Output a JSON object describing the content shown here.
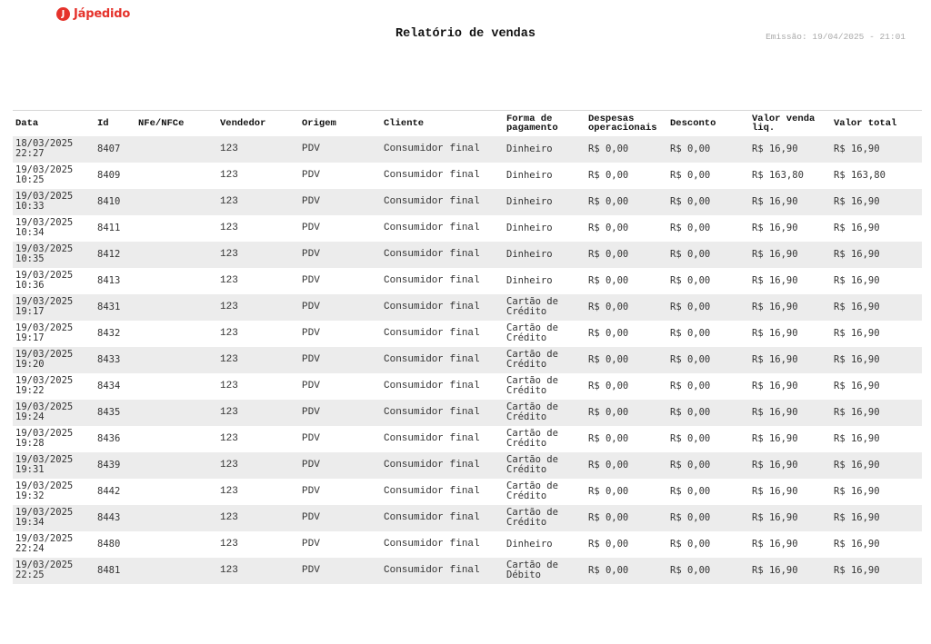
{
  "header": {
    "logo_text": "Jápedido",
    "title": "Relatório de vendas",
    "emission": "Emissão: 19/04/2025 - 21:01"
  },
  "table": {
    "columns": {
      "data": "Data",
      "id": "Id",
      "nfe": "NFe/NFCe",
      "vendedor": "Vendedor",
      "origem": "Origem",
      "cliente": "Cliente",
      "forma_1": "Forma de",
      "forma_2": "pagamento",
      "despesas_1": "Despesas",
      "despesas_2": "operacionais",
      "desconto": "Desconto",
      "liq_1": "Valor venda",
      "liq_2": "liq.",
      "total": "Valor total"
    },
    "rows": [
      {
        "date": "18/03/2025",
        "time": "22:27",
        "id": "8407",
        "nfe": "",
        "vendedor": "123",
        "origem": "PDV",
        "cliente": "Consumidor final",
        "pag_1": "Dinheiro",
        "pag_2": "",
        "despesas": "R$ 0,00",
        "desconto": "R$ 0,00",
        "liq": "R$ 16,90",
        "total": "R$ 16,90"
      },
      {
        "date": "19/03/2025",
        "time": "10:25",
        "id": "8409",
        "nfe": "",
        "vendedor": "123",
        "origem": "PDV",
        "cliente": "Consumidor final",
        "pag_1": "Dinheiro",
        "pag_2": "",
        "despesas": "R$ 0,00",
        "desconto": "R$ 0,00",
        "liq": "R$ 163,80",
        "total": "R$ 163,80"
      },
      {
        "date": "19/03/2025",
        "time": "10:33",
        "id": "8410",
        "nfe": "",
        "vendedor": "123",
        "origem": "PDV",
        "cliente": "Consumidor final",
        "pag_1": "Dinheiro",
        "pag_2": "",
        "despesas": "R$ 0,00",
        "desconto": "R$ 0,00",
        "liq": "R$ 16,90",
        "total": "R$ 16,90"
      },
      {
        "date": "19/03/2025",
        "time": "10:34",
        "id": "8411",
        "nfe": "",
        "vendedor": "123",
        "origem": "PDV",
        "cliente": "Consumidor final",
        "pag_1": "Dinheiro",
        "pag_2": "",
        "despesas": "R$ 0,00",
        "desconto": "R$ 0,00",
        "liq": "R$ 16,90",
        "total": "R$ 16,90"
      },
      {
        "date": "19/03/2025",
        "time": "10:35",
        "id": "8412",
        "nfe": "",
        "vendedor": "123",
        "origem": "PDV",
        "cliente": "Consumidor final",
        "pag_1": "Dinheiro",
        "pag_2": "",
        "despesas": "R$ 0,00",
        "desconto": "R$ 0,00",
        "liq": "R$ 16,90",
        "total": "R$ 16,90"
      },
      {
        "date": "19/03/2025",
        "time": "10:36",
        "id": "8413",
        "nfe": "",
        "vendedor": "123",
        "origem": "PDV",
        "cliente": "Consumidor final",
        "pag_1": "Dinheiro",
        "pag_2": "",
        "despesas": "R$ 0,00",
        "desconto": "R$ 0,00",
        "liq": "R$ 16,90",
        "total": "R$ 16,90"
      },
      {
        "date": "19/03/2025",
        "time": "19:17",
        "id": "8431",
        "nfe": "",
        "vendedor": "123",
        "origem": "PDV",
        "cliente": "Consumidor final",
        "pag_1": "Cartão de",
        "pag_2": "Crédito",
        "despesas": "R$ 0,00",
        "desconto": "R$ 0,00",
        "liq": "R$ 16,90",
        "total": "R$ 16,90"
      },
      {
        "date": "19/03/2025",
        "time": "19:17",
        "id": "8432",
        "nfe": "",
        "vendedor": "123",
        "origem": "PDV",
        "cliente": "Consumidor final",
        "pag_1": "Cartão de",
        "pag_2": "Crédito",
        "despesas": "R$ 0,00",
        "desconto": "R$ 0,00",
        "liq": "R$ 16,90",
        "total": "R$ 16,90"
      },
      {
        "date": "19/03/2025",
        "time": "19:20",
        "id": "8433",
        "nfe": "",
        "vendedor": "123",
        "origem": "PDV",
        "cliente": "Consumidor final",
        "pag_1": "Cartão de",
        "pag_2": "Crédito",
        "despesas": "R$ 0,00",
        "desconto": "R$ 0,00",
        "liq": "R$ 16,90",
        "total": "R$ 16,90"
      },
      {
        "date": "19/03/2025",
        "time": "19:22",
        "id": "8434",
        "nfe": "",
        "vendedor": "123",
        "origem": "PDV",
        "cliente": "Consumidor final",
        "pag_1": "Cartão de",
        "pag_2": "Crédito",
        "despesas": "R$ 0,00",
        "desconto": "R$ 0,00",
        "liq": "R$ 16,90",
        "total": "R$ 16,90"
      },
      {
        "date": "19/03/2025",
        "time": "19:24",
        "id": "8435",
        "nfe": "",
        "vendedor": "123",
        "origem": "PDV",
        "cliente": "Consumidor final",
        "pag_1": "Cartão de",
        "pag_2": "Crédito",
        "despesas": "R$ 0,00",
        "desconto": "R$ 0,00",
        "liq": "R$ 16,90",
        "total": "R$ 16,90"
      },
      {
        "date": "19/03/2025",
        "time": "19:28",
        "id": "8436",
        "nfe": "",
        "vendedor": "123",
        "origem": "PDV",
        "cliente": "Consumidor final",
        "pag_1": "Cartão de",
        "pag_2": "Crédito",
        "despesas": "R$ 0,00",
        "desconto": "R$ 0,00",
        "liq": "R$ 16,90",
        "total": "R$ 16,90"
      },
      {
        "date": "19/03/2025",
        "time": "19:31",
        "id": "8439",
        "nfe": "",
        "vendedor": "123",
        "origem": "PDV",
        "cliente": "Consumidor final",
        "pag_1": "Cartão de",
        "pag_2": "Crédito",
        "despesas": "R$ 0,00",
        "desconto": "R$ 0,00",
        "liq": "R$ 16,90",
        "total": "R$ 16,90"
      },
      {
        "date": "19/03/2025",
        "time": "19:32",
        "id": "8442",
        "nfe": "",
        "vendedor": "123",
        "origem": "PDV",
        "cliente": "Consumidor final",
        "pag_1": "Cartão de",
        "pag_2": "Crédito",
        "despesas": "R$ 0,00",
        "desconto": "R$ 0,00",
        "liq": "R$ 16,90",
        "total": "R$ 16,90"
      },
      {
        "date": "19/03/2025",
        "time": "19:34",
        "id": "8443",
        "nfe": "",
        "vendedor": "123",
        "origem": "PDV",
        "cliente": "Consumidor final",
        "pag_1": "Cartão de",
        "pag_2": "Crédito",
        "despesas": "R$ 0,00",
        "desconto": "R$ 0,00",
        "liq": "R$ 16,90",
        "total": "R$ 16,90"
      },
      {
        "date": "19/03/2025",
        "time": "22:24",
        "id": "8480",
        "nfe": "",
        "vendedor": "123",
        "origem": "PDV",
        "cliente": "Consumidor final",
        "pag_1": "Dinheiro",
        "pag_2": "",
        "despesas": "R$ 0,00",
        "desconto": "R$ 0,00",
        "liq": "R$ 16,90",
        "total": "R$ 16,90"
      },
      {
        "date": "19/03/2025",
        "time": "22:25",
        "id": "8481",
        "nfe": "",
        "vendedor": "123",
        "origem": "PDV",
        "cliente": "Consumidor final",
        "pag_1": "Cartão de",
        "pag_2": "Débito",
        "despesas": "R$ 0,00",
        "desconto": "R$ 0,00",
        "liq": "R$ 16,90",
        "total": "R$ 16,90"
      }
    ]
  }
}
